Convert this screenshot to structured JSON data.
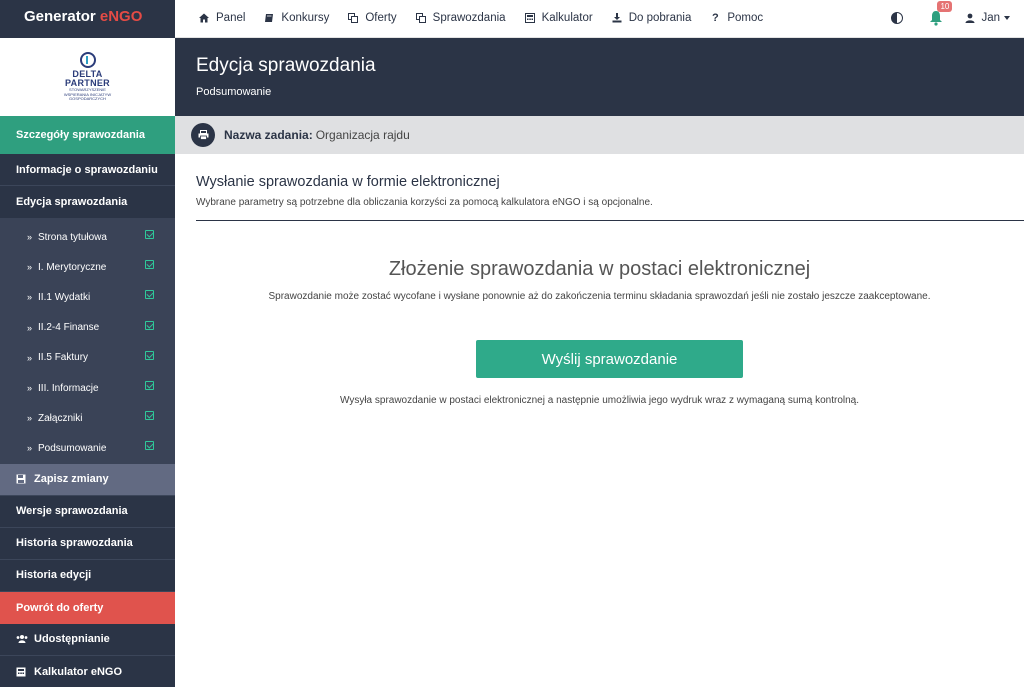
{
  "brand": {
    "name": "Generator",
    "accent": "eNGO"
  },
  "topnav": [
    {
      "label": "Panel",
      "icon": "home-icon"
    },
    {
      "label": "Konkursy",
      "icon": "book-icon"
    },
    {
      "label": "Oferty",
      "icon": "copy-icon"
    },
    {
      "label": "Sprawozdania",
      "icon": "copy-icon"
    },
    {
      "label": "Kalkulator",
      "icon": "calculator-icon"
    },
    {
      "label": "Do pobrania",
      "icon": "download-icon"
    },
    {
      "label": "Pomoc",
      "icon": "question-icon"
    }
  ],
  "notifications": {
    "count": "10"
  },
  "user": {
    "name": "Jan"
  },
  "logo": {
    "line1": "DELTA",
    "line2": "PARTNER",
    "sub": "STOWARZYSZENIE WSPIERANIA INICJATYW GOSPODARCZYCH"
  },
  "sidebar": {
    "details": "Szczegóły sprawozdania",
    "info": "Informacje o sprawozdaniu",
    "edit": "Edycja sprawozdania",
    "subitems": [
      "Strona tytułowa",
      "I. Merytoryczne",
      "II.1 Wydatki",
      "II.2-4 Finanse",
      "II.5 Faktury",
      "III. Informacje",
      "Załączniki",
      "Podsumowanie"
    ],
    "save": "Zapisz zmiany",
    "versions": "Wersje sprawozdania",
    "history": "Historia sprawozdania",
    "edit_history": "Historia edycji",
    "back": "Powrót do oferty",
    "share": "Udostępnianie",
    "calculator": "Kalkulator eNGO"
  },
  "header": {
    "title": "Edycja sprawozdania",
    "subtitle": "Podsumowanie"
  },
  "task": {
    "label": "Nazwa zadania:",
    "value": "Organizacja rajdu"
  },
  "section": {
    "title": "Wysłanie sprawozdania w formie elektronicznej",
    "desc": "Wybrane parametry są potrzebne dla obliczania korzyści za pomocą kalkulatora eNGO i są opcjonalne."
  },
  "submit": {
    "title": "Złożenie sprawozdania w postaci elektronicznej",
    "desc": "Sprawozdanie może zostać wycofane i wysłane ponownie aż do zakończenia terminu składania sprawozdań jeśli nie zostało jeszcze zaakceptowane.",
    "button": "Wyślij sprawozdanie",
    "note": "Wysyła sprawozdanie w postaci elektronicznej a następnie umożliwia jego wydruk wraz z wymaganą sumą kontrolną."
  },
  "colors": {
    "navy": "#2b3446",
    "green": "#2f9f7f",
    "red": "#e0534d",
    "accent": "#e44b45"
  }
}
